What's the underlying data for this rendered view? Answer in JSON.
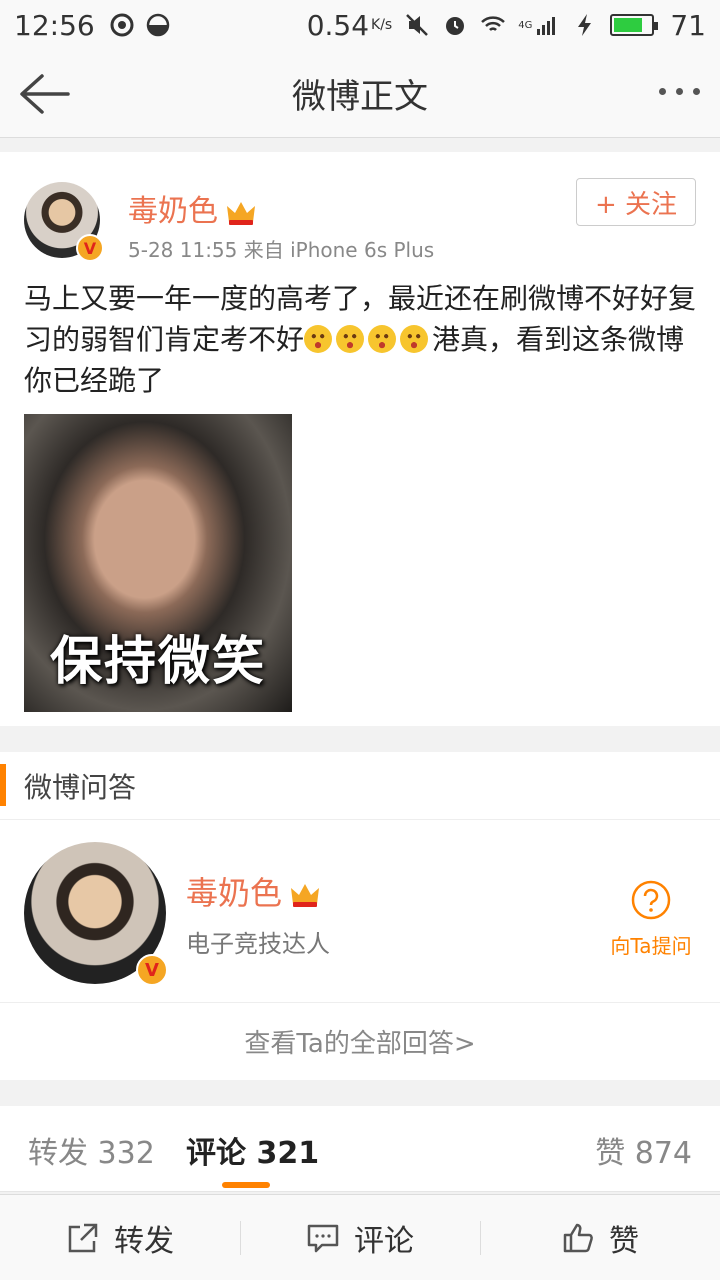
{
  "status_bar": {
    "time": "12:56",
    "net_speed": "0.54",
    "net_unit": "K/s",
    "signal_label": "4G",
    "battery": "71"
  },
  "nav": {
    "title": "微博正文"
  },
  "post": {
    "author": "毒奶色",
    "meta": "5-28 11:55   来自 iPhone 6s Plus",
    "follow_label": "+ 关注",
    "text_part1": "马上又要一年一度的高考了，最近还在刷微博不好好复习的弱智们肯定考不好",
    "text_part2": "港真，看到这条微博你已经跪了",
    "image_caption": "保持微笑"
  },
  "qa": {
    "header": "微博问答",
    "name": "毒奶色",
    "title": "电子竞技达人",
    "ask_label": "向Ta提问",
    "view_all": "查看Ta的全部回答>"
  },
  "tabs": {
    "repost": "转发 332",
    "comment": "评论 321",
    "like": "赞 874"
  },
  "toolbar": {
    "repost": "转发",
    "comment": "评论",
    "like": "赞"
  },
  "colors": {
    "accent": "#ff8200",
    "name": "#eb7350"
  }
}
